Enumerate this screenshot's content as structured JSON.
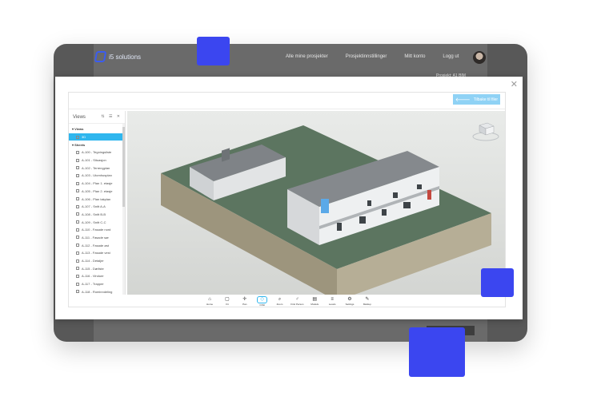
{
  "app": {
    "brand": "i5 solutions",
    "nav": [
      "Alle mine prosjekter",
      "Prosjektinnstillinger",
      "Mitt konto",
      "Logg ut"
    ],
    "subheader_right": "Prosjekt: A1 BIM"
  },
  "viewer": {
    "back_button_label": "Tilbake til filer",
    "sidebar": {
      "title": "Views",
      "tools": "⇅ ☰ ✕",
      "items": [
        {
          "type": "group",
          "label": "▾ Views"
        },
        {
          "type": "item",
          "label": "3D",
          "selected": true
        },
        {
          "type": "group",
          "label": "▾ Sheets"
        },
        {
          "type": "item",
          "label": "A-100 - Tegningsliste"
        },
        {
          "type": "item",
          "label": "A-101 - Situasjon"
        },
        {
          "type": "item",
          "label": "A-102 - Terrengplan"
        },
        {
          "type": "item",
          "label": "A-103 - Utomhusplan"
        },
        {
          "type": "item",
          "label": "A-104 - Plan 1. etasje"
        },
        {
          "type": "item",
          "label": "A-105 - Plan 2. etasje"
        },
        {
          "type": "item",
          "label": "A-106 - Plan takplan"
        },
        {
          "type": "item",
          "label": "A-107 - Snitt A-A"
        },
        {
          "type": "item",
          "label": "A-108 - Snitt B-B"
        },
        {
          "type": "item",
          "label": "A-109 - Snitt C-C"
        },
        {
          "type": "item",
          "label": "A-110 - Fasade nord"
        },
        {
          "type": "item",
          "label": "A-111 - Fasade sør"
        },
        {
          "type": "item",
          "label": "A-112 - Fasade øst"
        },
        {
          "type": "item",
          "label": "A-113 - Fasade vest"
        },
        {
          "type": "item",
          "label": "A-114 - Detaljer"
        },
        {
          "type": "item",
          "label": "A-115 - Dørliste"
        },
        {
          "type": "item",
          "label": "A-116 - Vinduer"
        },
        {
          "type": "item",
          "label": "A-117 - Trapper"
        },
        {
          "type": "item",
          "label": "A-118 - Rominndeling"
        }
      ]
    },
    "toolbar": [
      {
        "icon": "home-icon",
        "glyph": "⌂",
        "label": "Home"
      },
      {
        "icon": "fit-icon",
        "glyph": "▢",
        "label": "Fit"
      },
      {
        "icon": "pan-icon",
        "glyph": "✛",
        "label": "Pan"
      },
      {
        "icon": "orbit-icon",
        "glyph": "◇",
        "label": "Orbit",
        "active": true
      },
      {
        "icon": "zoom-icon",
        "glyph": "⌕",
        "label": "Zoom"
      },
      {
        "icon": "first-person-icon",
        "glyph": "♂",
        "label": "First Person"
      },
      {
        "icon": "models-icon",
        "glyph": "▤",
        "label": "Models"
      },
      {
        "icon": "levels-icon",
        "glyph": "≡",
        "label": "Levels"
      },
      {
        "icon": "settings-icon",
        "glyph": "⚙",
        "label": "Settings"
      },
      {
        "icon": "markup-icon",
        "glyph": "✎",
        "label": "Markup"
      }
    ]
  },
  "colors": {
    "accent_square": "#3b46f0",
    "selection": "#2fb6ee",
    "device": "#585858"
  }
}
